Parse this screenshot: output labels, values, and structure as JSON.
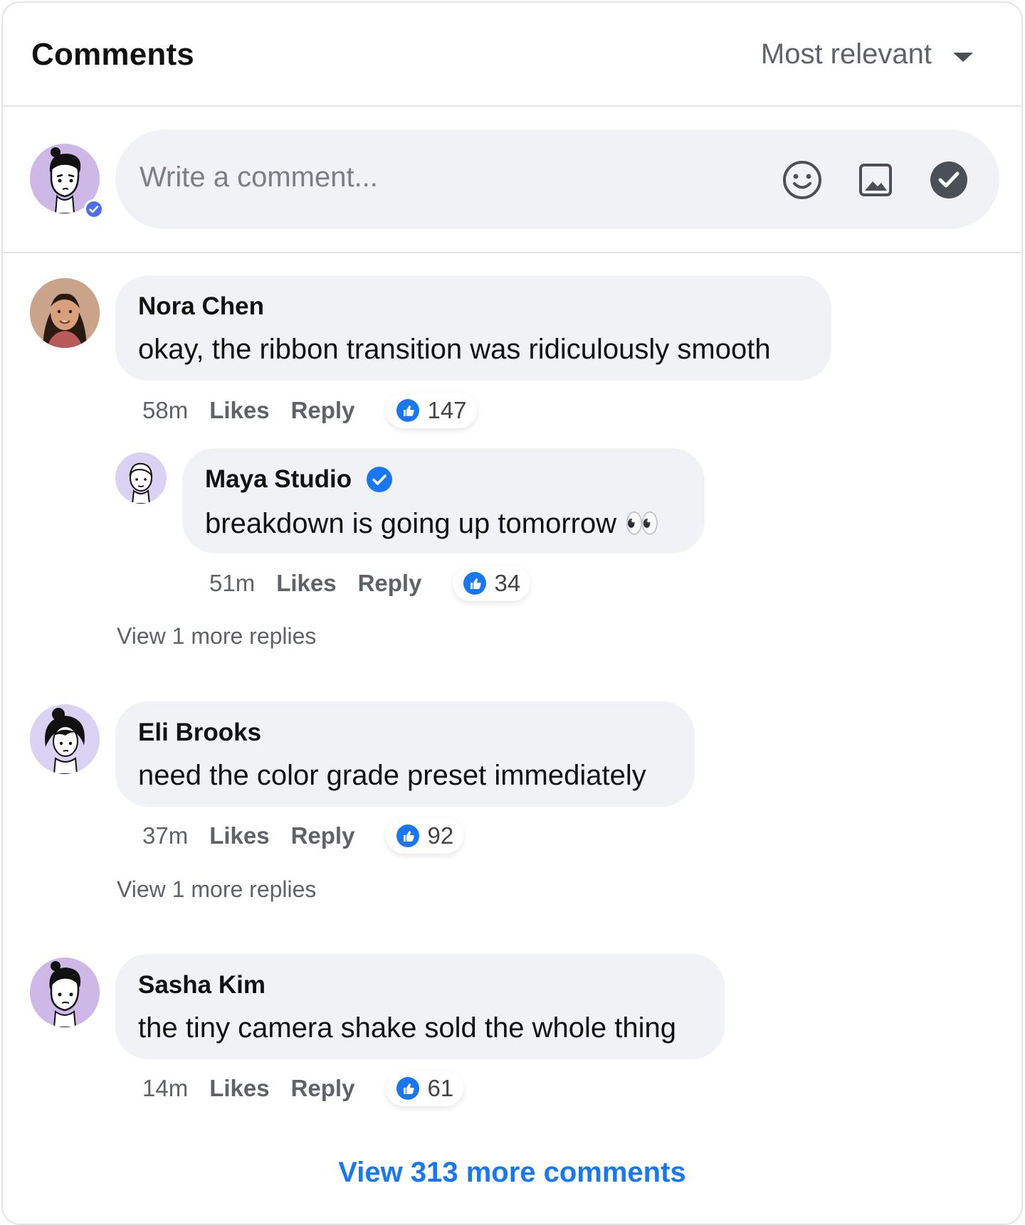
{
  "header": {
    "title": "Comments",
    "sort_label": "Most relevant"
  },
  "composer": {
    "placeholder": "Write a comment..."
  },
  "comments": [
    {
      "author": "Nora Chen",
      "text": "okay, the ribbon transition was ridiculously smooth",
      "time": "58m",
      "likes_label": "Likes",
      "reply_label": "Reply",
      "reaction_count": "147"
    },
    {
      "author": "Eli Brooks",
      "text": "need the color grade preset immediately",
      "time": "37m",
      "likes_label": "Likes",
      "reply_label": "Reply",
      "reaction_count": "92",
      "more_replies": "View 1 more replies"
    },
    {
      "author": "Sasha Kim",
      "text": "the tiny camera shake sold the whole thing",
      "time": "14m",
      "likes_label": "Likes",
      "reply_label": "Reply",
      "reaction_count": "61"
    }
  ],
  "reply": {
    "author": "Maya Studio",
    "text": "breakdown is going up tomorrow 👀",
    "time": "51m",
    "likes_label": "Likes",
    "reply_label": "Reply",
    "reaction_count": "34",
    "more_replies": "View 1 more replies"
  },
  "footer": {
    "view_more": "View 313 more comments"
  },
  "colors": {
    "accent": "#1877f2",
    "bubble": "#f0f2f5",
    "muted_text": "#5f6368"
  },
  "icons": [
    "chevron-down-icon",
    "emoji-icon",
    "image-icon",
    "send-check-icon",
    "verified-icon",
    "like-icon"
  ]
}
